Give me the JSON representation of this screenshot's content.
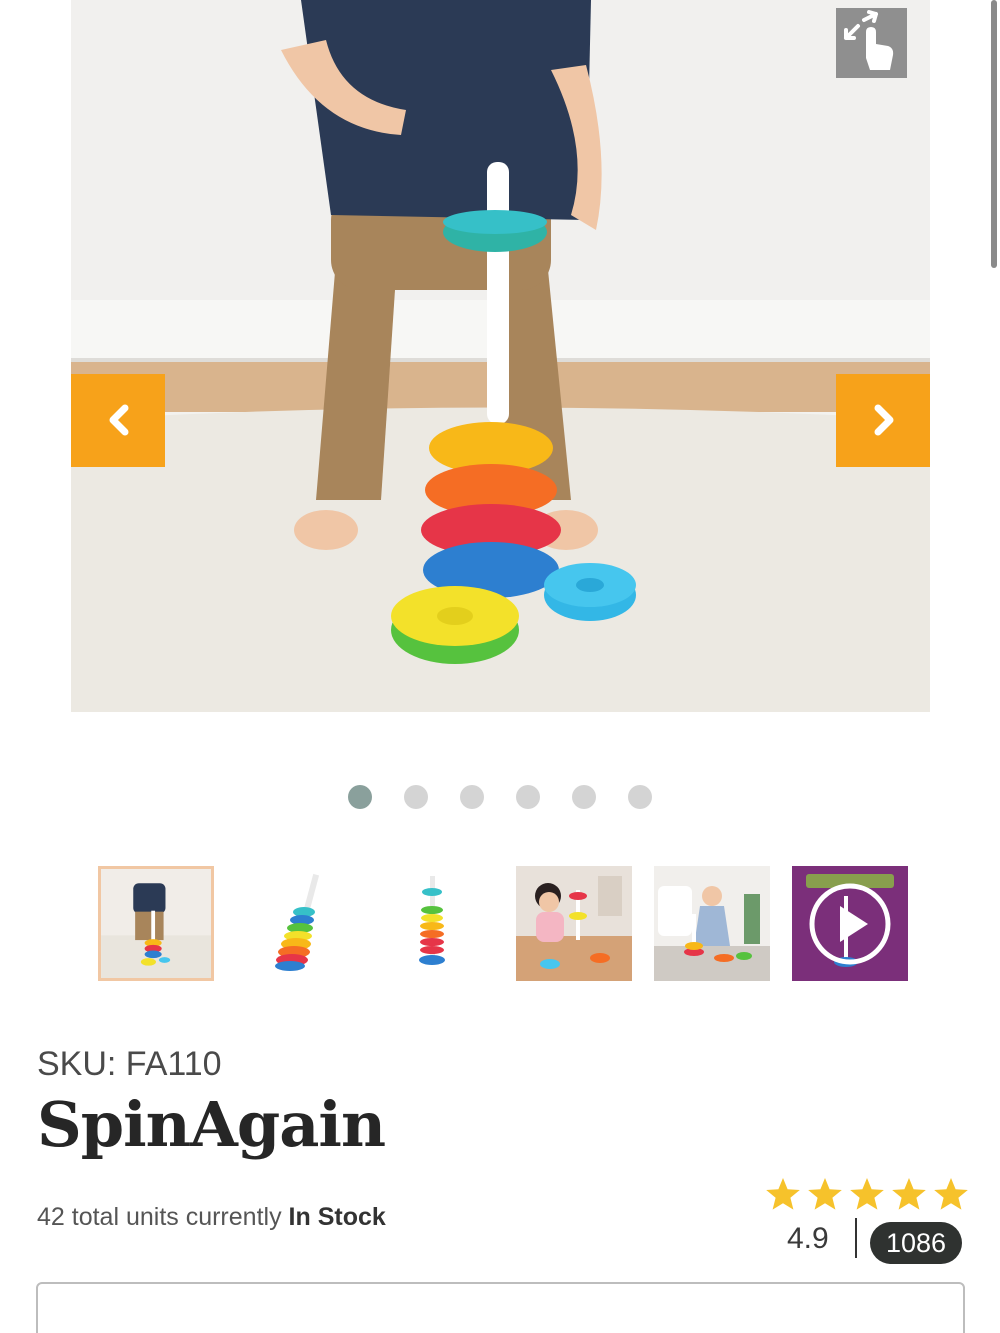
{
  "gallery": {
    "main_image": "toddler-with-spinagain-toy-photo",
    "zoom_icon": "pinch-zoom-icon",
    "prev_icon": "chevron-left-icon",
    "next_icon": "chevron-right-icon",
    "dot_count": 6,
    "active_dot": 1,
    "thumbnails": [
      {
        "name": "thumb-toddler-playing",
        "selected": true
      },
      {
        "name": "thumb-toy-tilted"
      },
      {
        "name": "thumb-toy-upright"
      },
      {
        "name": "thumb-baby-with-toy"
      },
      {
        "name": "thumb-toddler-living-room"
      },
      {
        "name": "thumb-video",
        "icon": "play-icon"
      }
    ]
  },
  "product": {
    "sku_label": "SKU: FA110",
    "title": "SpinAgain",
    "stock_prefix": "42 total units currently",
    "stock_status": "In Stock",
    "rating": "4.9",
    "review_count": "1086",
    "star_count": 5
  },
  "colors": {
    "accent": "#f7a21a",
    "star": "#f6c22b",
    "pill": "#2f3230",
    "active_dot": "#8aa09c"
  }
}
